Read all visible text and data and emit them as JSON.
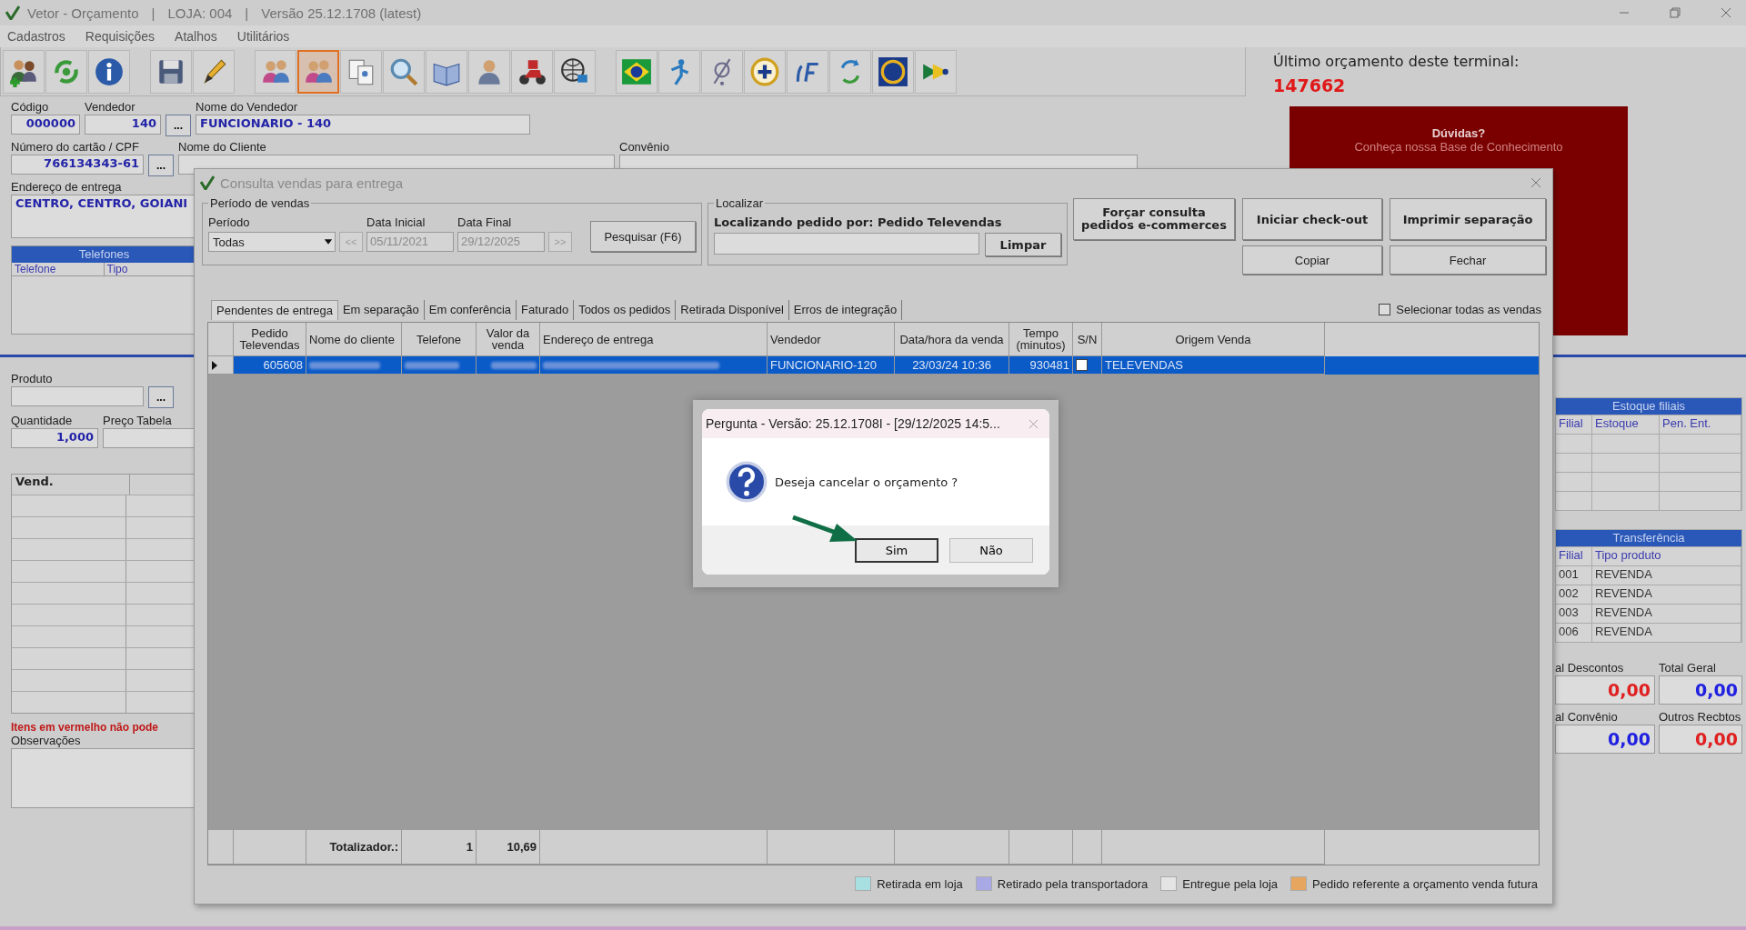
{
  "window": {
    "title": "Vetor - Orçamento",
    "separator": "|",
    "store": "LOJA: 004",
    "version": "Versão 25.12.1708 (latest)"
  },
  "menu": [
    "Cadastros",
    "Requisições",
    "Atalhos",
    "Utilitários"
  ],
  "toolbar": [
    {
      "selected": false
    },
    {
      "selected": false
    },
    {
      "selected": false
    },
    {
      "selected": false
    },
    {
      "selected": false
    },
    {
      "selected": false
    },
    {
      "selected": true
    },
    {
      "selected": false
    },
    {
      "selected": false
    },
    {
      "selected": false
    },
    {
      "selected": false
    },
    {
      "selected": false
    },
    {
      "selected": false
    },
    {
      "selected": false
    },
    {
      "selected": false
    },
    {
      "selected": false
    },
    {
      "selected": false
    },
    {
      "selected": false
    },
    {
      "selected": false
    },
    {
      "selected": false
    },
    {
      "selected": false
    }
  ],
  "last_budget": {
    "label": "Último orçamento deste terminal:",
    "number": "147662"
  },
  "help": {
    "title": "Dúvidas?",
    "text": "Conheça nossa Base de Conhecimento"
  },
  "form": {
    "code_label": "Código",
    "code": "000000",
    "seller_label": "Vendedor",
    "seller": "140",
    "lookup": "...",
    "seller_name_label": "Nome do Vendedor",
    "seller_name": "FUNCIONARIO - 140",
    "card_label": "Número do cartão / CPF",
    "card": "766134343-61",
    "client_label": "Nome do Cliente",
    "agreement_label": "Convênio",
    "address_label": "Endereço de entrega",
    "address": "CENTRO, CENTRO, GOIANI"
  },
  "phones": {
    "title": "Telefones",
    "columns": [
      "Telefone",
      "Tipo"
    ]
  },
  "product": {
    "label": "Produto",
    "lookup": "...",
    "quantity_label": "Quantidade",
    "quantity": "1,000",
    "price_label": "Preço Tabela"
  },
  "items": {
    "columns": [
      "Vend."
    ]
  },
  "warning": "Itens em vermelho não pode",
  "notes_label": "Observações",
  "stock": {
    "title": "Estoque filiais",
    "columns": [
      "Filial",
      "Estoque",
      "Pen. Ent."
    ]
  },
  "transfer": {
    "title": "Transferência",
    "columns": [
      "Filial",
      "Tipo produto"
    ],
    "rows": [
      [
        "001",
        "REVENDA"
      ],
      [
        "002",
        "REVENDA"
      ],
      [
        "003",
        "REVENDA"
      ],
      [
        "006",
        "REVENDA"
      ]
    ]
  },
  "totals": [
    {
      "label": "al Descontos",
      "value": "0,00",
      "color": "#e02020"
    },
    {
      "label": "Total Geral",
      "value": "0,00",
      "color": "#2020e0"
    },
    {
      "label": "al Convênio",
      "value": "0,00",
      "color": "#2020e0"
    },
    {
      "label": "Outros Recbtos",
      "value": "0,00",
      "color": "#e02020"
    }
  ],
  "dialog": {
    "title": "Consulta vendas para entrega",
    "period_group": "Período de vendas",
    "period_label": "Período",
    "period": "Todas",
    "start_label": "Data Inicial",
    "start": "05/11/2021",
    "end_label": "Data Final",
    "end": "29/12/2025",
    "prev": "<<",
    "next": ">>",
    "search": "Pesquisar (F6)",
    "locate_group": "Localizar",
    "locate_text": "Localizando pedido por: Pedido Televendas",
    "clear": "Limpar",
    "buttons": [
      "Forçar consulta pedidos e-commerces",
      "Iniciar check-out",
      "Imprimir separação",
      "Copiar",
      "Fechar"
    ],
    "select_all": {
      "label": "Selecionar todas as vendas",
      "checked": false
    },
    "tabs": [
      {
        "label": "Pendentes de entrega",
        "selected": true
      },
      {
        "label": "Em separação",
        "selected": false
      },
      {
        "label": "Em conferência",
        "selected": false
      },
      {
        "label": "Faturado",
        "selected": false
      },
      {
        "label": "Todos os pedidos",
        "selected": false
      },
      {
        "label": "Retirada Disponível",
        "selected": false
      },
      {
        "label": "Erros de integração",
        "selected": false
      }
    ],
    "table": {
      "columns": [
        "Pedido Televendas",
        "Nome do cliente",
        "Telefone",
        "Valor da venda",
        "Endereço de entrega",
        "Vendedor",
        "Data/hora da venda",
        "Tempo (minutos)",
        "S/N",
        "Origem Venda"
      ],
      "rows": [
        {
          "selected": true,
          "checked": false,
          "cells": [
            "605608",
            null,
            null,
            null,
            null,
            "FUNCIONARIO-120",
            "23/03/24 10:36",
            "930481",
            null,
            "TELEVENDAS"
          ]
        }
      ],
      "totals": {
        "label": "Totalizador.:",
        "count": "1",
        "value": "10,69"
      }
    },
    "legend": [
      {
        "label": "Retirada em loja",
        "color": "#a8e0e2"
      },
      {
        "label": "Retirado pela transportadora",
        "color": "#a9a9e6"
      },
      {
        "label": "Entregue pela loja",
        "color": "#e4e4e4"
      },
      {
        "label": "Pedido referente a orçamento venda futura",
        "color": "#e6a660"
      }
    ]
  },
  "question": {
    "title": "Pergunta - Versão: 25.12.1708I - [29/12/2025 14:5...",
    "message": "Deseja cancelar o orçamento ?",
    "buttons": [
      {
        "label": "Sim",
        "focused": true
      },
      {
        "label": "Não",
        "focused": false
      }
    ]
  }
}
